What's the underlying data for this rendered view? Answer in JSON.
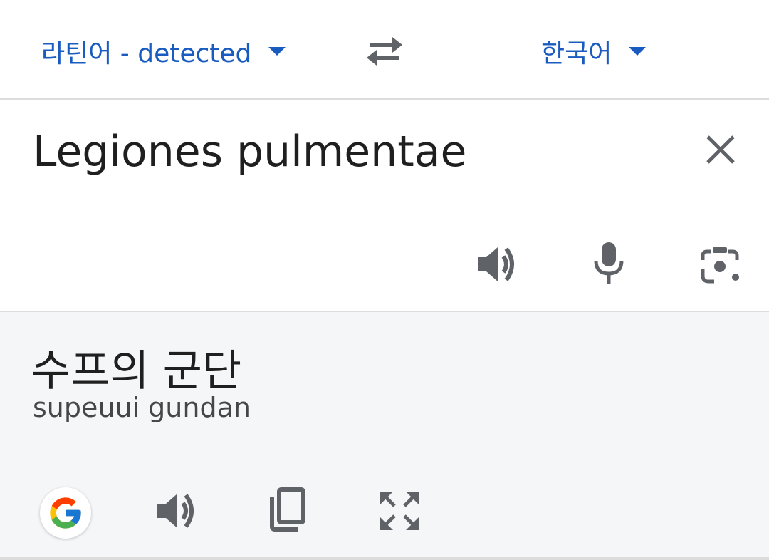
{
  "language_bar": {
    "source_language": "라틴어 - detected",
    "target_language": "한국어",
    "swap_icon": "swap-arrows-icon",
    "caret_icon": "caret-down-icon"
  },
  "input": {
    "text": "Legiones pulmentae",
    "clear_icon": "close-icon",
    "actions": [
      "speaker-icon",
      "microphone-icon",
      "camera-icon"
    ]
  },
  "output": {
    "translation": "수프의 군단",
    "romanization": "supeuui gundan",
    "actions": [
      "google-logo-icon",
      "speaker-icon",
      "copy-icon",
      "fullscreen-icon"
    ]
  },
  "colors": {
    "accent": "#1a5bbf",
    "icon": "#5f6368",
    "output_bg": "#f5f6f8",
    "divider": "#dcdcdc"
  }
}
